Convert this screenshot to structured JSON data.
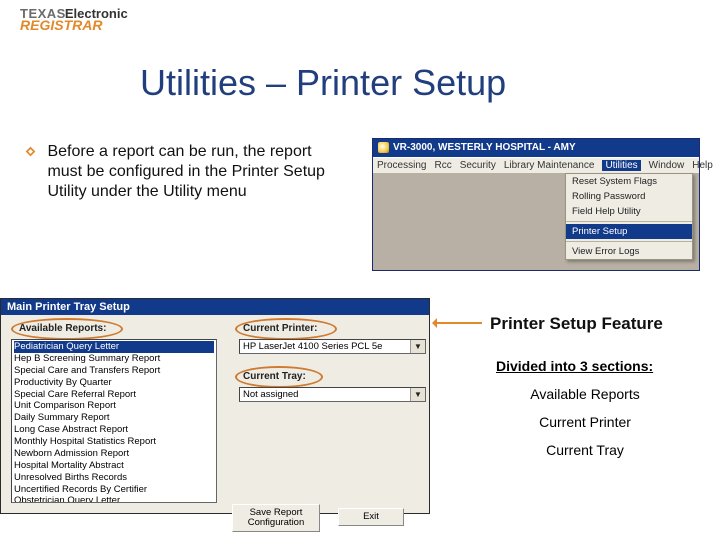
{
  "logo": {
    "texas": "TEXAS",
    "electronic": "Electronic",
    "registrar": "REGISTRAR"
  },
  "title": "Utilities – Printer Setup",
  "bullet": "Before a report can be run, the report must be configured in the Printer Setup Utility under the Utility menu",
  "app": {
    "title": "VR-3000, WESTERLY HOSPITAL - AMY",
    "menu": [
      "Processing",
      "Rcc",
      "Security",
      "Library Maintenance",
      "Utilities",
      "Window",
      "Help"
    ],
    "menu_hl_index": 4,
    "dropdown": {
      "items": [
        "Reset System Flags",
        "Rolling Password",
        "Field Help Utility",
        "Printer Setup",
        "View Error Logs"
      ],
      "selected_index": 3
    }
  },
  "printer_setup": {
    "window_title": "Main Printer Tray Setup",
    "labels": {
      "available": "Available Reports:",
      "current_printer": "Current Printer:",
      "current_tray": "Current Tray:"
    },
    "reports": [
      "Pediatrician Query Letter",
      "Hep B Screening Summary Report",
      "Special Care and Transfers Report",
      "Productivity By Quarter",
      "Special Care Referral Report",
      "Unit Comparison Report",
      "Daily Summary Report",
      "Long Case Abstract Report",
      "Monthly Hospital Statistics Report",
      "Newborn Admission Report",
      "Hospital Mortality Abstract",
      "Unresolved Births Records",
      "Uncertified Records By Certifier",
      "Obstetrician Query Letter"
    ],
    "reports_selected_index": 0,
    "current_printer_value": "HP LaserJet 4100 Series PCL 5e",
    "current_tray_value": "Not assigned",
    "buttons": {
      "save": "Save Report\nConfiguration",
      "exit": "Exit"
    }
  },
  "callout": {
    "feature": "Printer Setup Feature",
    "divided": "Divided into 3 sections:",
    "sections": [
      "Available Reports",
      "Current Printer",
      "Current Tray"
    ]
  }
}
